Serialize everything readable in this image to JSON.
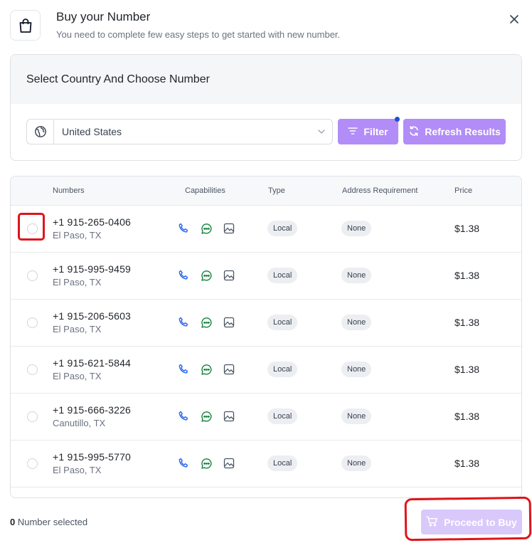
{
  "header": {
    "title": "Buy your Number",
    "subtitle": "You need to complete few easy steps to get started with new number."
  },
  "selector": {
    "title": "Select Country And Choose Number",
    "country": "United States",
    "filter_label": "Filter",
    "refresh_label": "Refresh Results"
  },
  "table": {
    "columns": [
      "Numbers",
      "Capabilities",
      "Type",
      "Address Requirement",
      "Price"
    ],
    "rows": [
      {
        "number": "+1 915-265-0406",
        "city": "El Paso, TX",
        "type": "Local",
        "address": "None",
        "price": "$1.38"
      },
      {
        "number": "+1 915-995-9459",
        "city": "El Paso, TX",
        "type": "Local",
        "address": "None",
        "price": "$1.38"
      },
      {
        "number": "+1 915-206-5603",
        "city": "El Paso, TX",
        "type": "Local",
        "address": "None",
        "price": "$1.38"
      },
      {
        "number": "+1 915-621-5844",
        "city": "El Paso, TX",
        "type": "Local",
        "address": "None",
        "price": "$1.38"
      },
      {
        "number": "+1 915-666-3226",
        "city": "Canutillo, TX",
        "type": "Local",
        "address": "None",
        "price": "$1.38"
      },
      {
        "number": "+1 915-995-5770",
        "city": "El Paso, TX",
        "type": "Local",
        "address": "None",
        "price": "$1.38"
      }
    ]
  },
  "footer": {
    "selected_count": "0",
    "selected_label": "Number selected",
    "buy_label": "Proceed to Buy"
  },
  "icons": {
    "header": "shopping-bag-icon",
    "close": "close-icon",
    "country": "globe-icon",
    "dropdown": "chevron-down-icon",
    "filter": "filter-lines-icon",
    "refresh": "refresh-icon",
    "capabilities": [
      "phone-icon",
      "sms-icon",
      "mms-image-icon"
    ],
    "buy": "cart-icon"
  },
  "colors": {
    "accent": "#b28cf7",
    "accent_disabled": "#d9c9fb",
    "phone_icon": "#2563eb",
    "sms_icon": "#15803d",
    "annotation": "#e0141b"
  }
}
